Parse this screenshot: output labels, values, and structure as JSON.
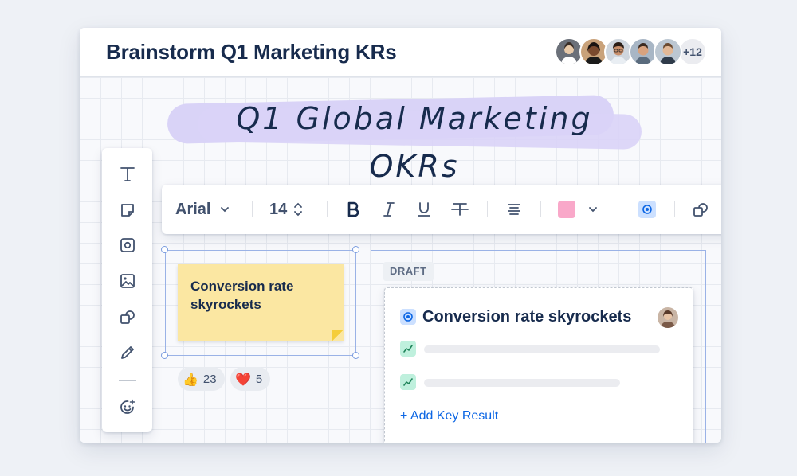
{
  "header": {
    "title": "Brainstorm Q1 Marketing KRs",
    "collaborators_more": "+12"
  },
  "collaborators": [
    {
      "name": "avatar-1",
      "bg": "#8a8f98"
    },
    {
      "name": "avatar-2",
      "bg": "#d9b48c"
    },
    {
      "name": "avatar-3",
      "bg": "#c9d2db"
    },
    {
      "name": "avatar-4",
      "bg": "#9fb0c2"
    },
    {
      "name": "avatar-5",
      "bg": "#b9c4cf"
    }
  ],
  "canvas": {
    "banner_text": "Q1 Global Marketing OKRs"
  },
  "toolbox": {
    "tools": [
      "text-tool",
      "sticky-note-tool",
      "goal-tool",
      "image-tool",
      "shapes-tool",
      "pen-tool",
      "reactions-tool"
    ]
  },
  "format_bar": {
    "font": "Arial",
    "size": "14",
    "text_color": "#f9a8c9",
    "goal_color": "#cce0ff"
  },
  "sticky_note": {
    "text": "Conversion rate skyrockets",
    "color": "#fbe7a2"
  },
  "reactions": [
    {
      "emoji": "👍",
      "count": "23"
    },
    {
      "emoji": "❤️",
      "count": "5"
    }
  ],
  "draft": {
    "badge": "DRAFT",
    "card_title": "Conversion rate skyrockets",
    "add_key_result": "+ Add Key Result"
  }
}
